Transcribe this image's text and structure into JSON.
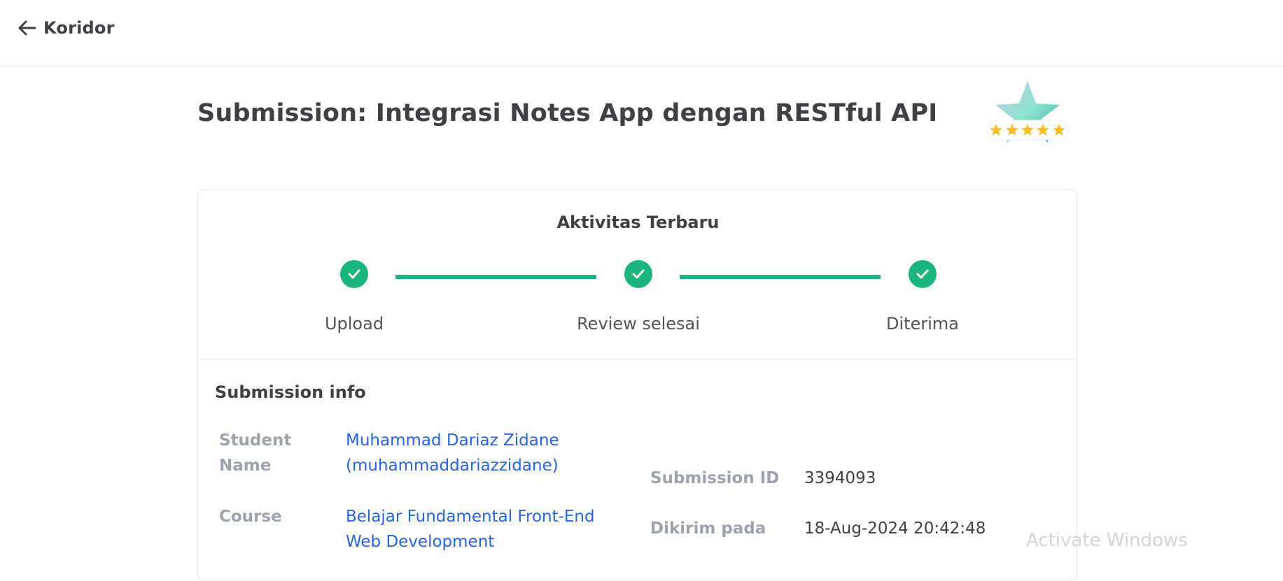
{
  "header": {
    "back_label": "Koridor"
  },
  "page": {
    "title": "Submission: Integrasi Notes App dengan RESTful API"
  },
  "activity": {
    "title": "Aktivitas Terbaru",
    "steps": [
      {
        "label": "Upload",
        "status": "done"
      },
      {
        "label": "Review selesai",
        "status": "done"
      },
      {
        "label": "Diterima",
        "status": "done"
      }
    ]
  },
  "submission_info": {
    "title": "Submission info",
    "student_label_1": "Student",
    "student_label_2": "Name",
    "student_name": "Muhammad Dariaz Zidane",
    "student_username": "(muhammaddariazzidane)",
    "course_label": "Course",
    "course_line_1": "Belajar Fundamental Front-End",
    "course_line_2": "Web Development",
    "submission_id_label": "Submission ID",
    "submission_id": "3394093",
    "sent_label": "Dikirim pada",
    "sent_at": "18-Aug-2024 20:42:48"
  },
  "colors": {
    "accent_green": "#1ab67e",
    "link_blue": "#2563eb",
    "star_yellow": "#fbbf24"
  },
  "badge": {
    "icon": "five-star-rating-badge",
    "stars": 5
  },
  "watermark_text": "Activate Windows"
}
